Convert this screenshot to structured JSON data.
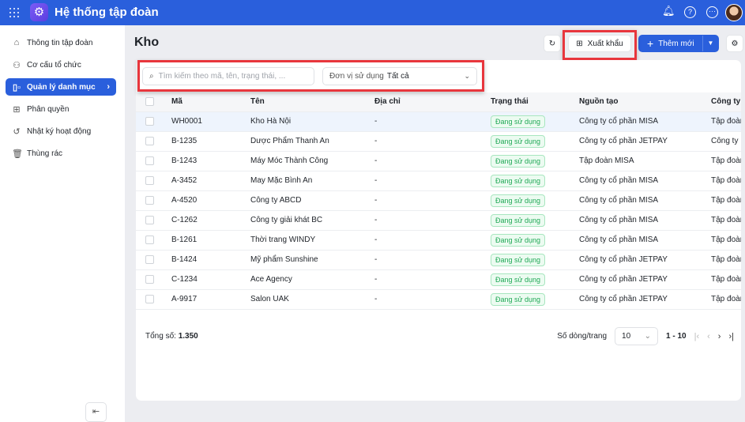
{
  "app": {
    "title": "Hệ thống tập đoàn",
    "icons": [
      "apps-grid-icon",
      "gear-logo-icon",
      "bell-icon",
      "help-icon",
      "more-icon",
      "avatar"
    ]
  },
  "sidebar": {
    "items": [
      {
        "label": "Thông tin tập đoàn",
        "icon": "home-icon"
      },
      {
        "label": "Cơ cấu tổ chức",
        "icon": "org-chart-icon"
      },
      {
        "label": "Quản lý danh mục",
        "icon": "catalog-icon",
        "active": true
      },
      {
        "label": "Phân quyền",
        "icon": "permission-icon"
      },
      {
        "label": "Nhật ký hoạt động",
        "icon": "history-icon"
      },
      {
        "label": "Thùng rác",
        "icon": "trash-icon"
      }
    ]
  },
  "page": {
    "title": "Kho"
  },
  "toolbar": {
    "export_label": "Xuất khẩu",
    "add_label": "Thêm mới"
  },
  "filters": {
    "search_placeholder": "Tìm kiếm theo mã, tên, trạng thái, ...",
    "unit_label": "Đơn vị sử dụng",
    "unit_value": "Tất cả"
  },
  "table": {
    "columns": [
      "Mã",
      "Tên",
      "Địa chỉ",
      "Trạng thái",
      "Nguồn tạo",
      "Công ty"
    ],
    "rows": [
      [
        "WH0001",
        "Kho Hà Nội",
        "-",
        "Đang sử dụng",
        "Công ty cổ phần MISA",
        "Tập đoàn"
      ],
      [
        "B-1235",
        "Dược Phẩm Thanh An",
        "-",
        "Đang sử dụng",
        "Công ty cổ phần JETPAY",
        "Công ty"
      ],
      [
        "B-1243",
        "Máy Móc Thành Công",
        "-",
        "Đang sử dụng",
        "Tập đoàn MISA",
        "Tập đoàn"
      ],
      [
        "A-3452",
        "May Mặc Bình An",
        "-",
        "Đang sử dụng",
        "Công ty cổ phần MISA",
        "Tập đoàn"
      ],
      [
        "A-4520",
        "Công ty ABCD",
        "-",
        "Đang sử dụng",
        "Công ty cổ phần MISA",
        "Tập đoàn"
      ],
      [
        "C-1262",
        "Công ty giải khát BC",
        "-",
        "Đang sử dụng",
        "Công ty cổ phần MISA",
        "Tập đoàn"
      ],
      [
        "B-1261",
        "Thời trang WINDY",
        "-",
        "Đang sử dụng",
        "Công ty cổ phần MISA",
        "Tập đoàn"
      ],
      [
        "B-1424",
        "Mỹ phẩm Sunshine",
        "-",
        "Đang sử dụng",
        "Công ty cổ phần JETPAY",
        "Tập đoàn"
      ],
      [
        "C-1234",
        "Ace Agency",
        "-",
        "Đang sử dụng",
        "Công ty cổ phần JETPAY",
        "Tập đoàn"
      ],
      [
        "A-9917",
        "Salon UAK",
        "-",
        "Đang sử dụng",
        "Công ty cổ phần JETPAY",
        "Tập đoàn"
      ]
    ]
  },
  "footer": {
    "total_label": "Tổng số:",
    "total_value": "1.350",
    "page_size_label": "Số dòng/trang",
    "page_size": "10",
    "range": "1 - 10"
  }
}
